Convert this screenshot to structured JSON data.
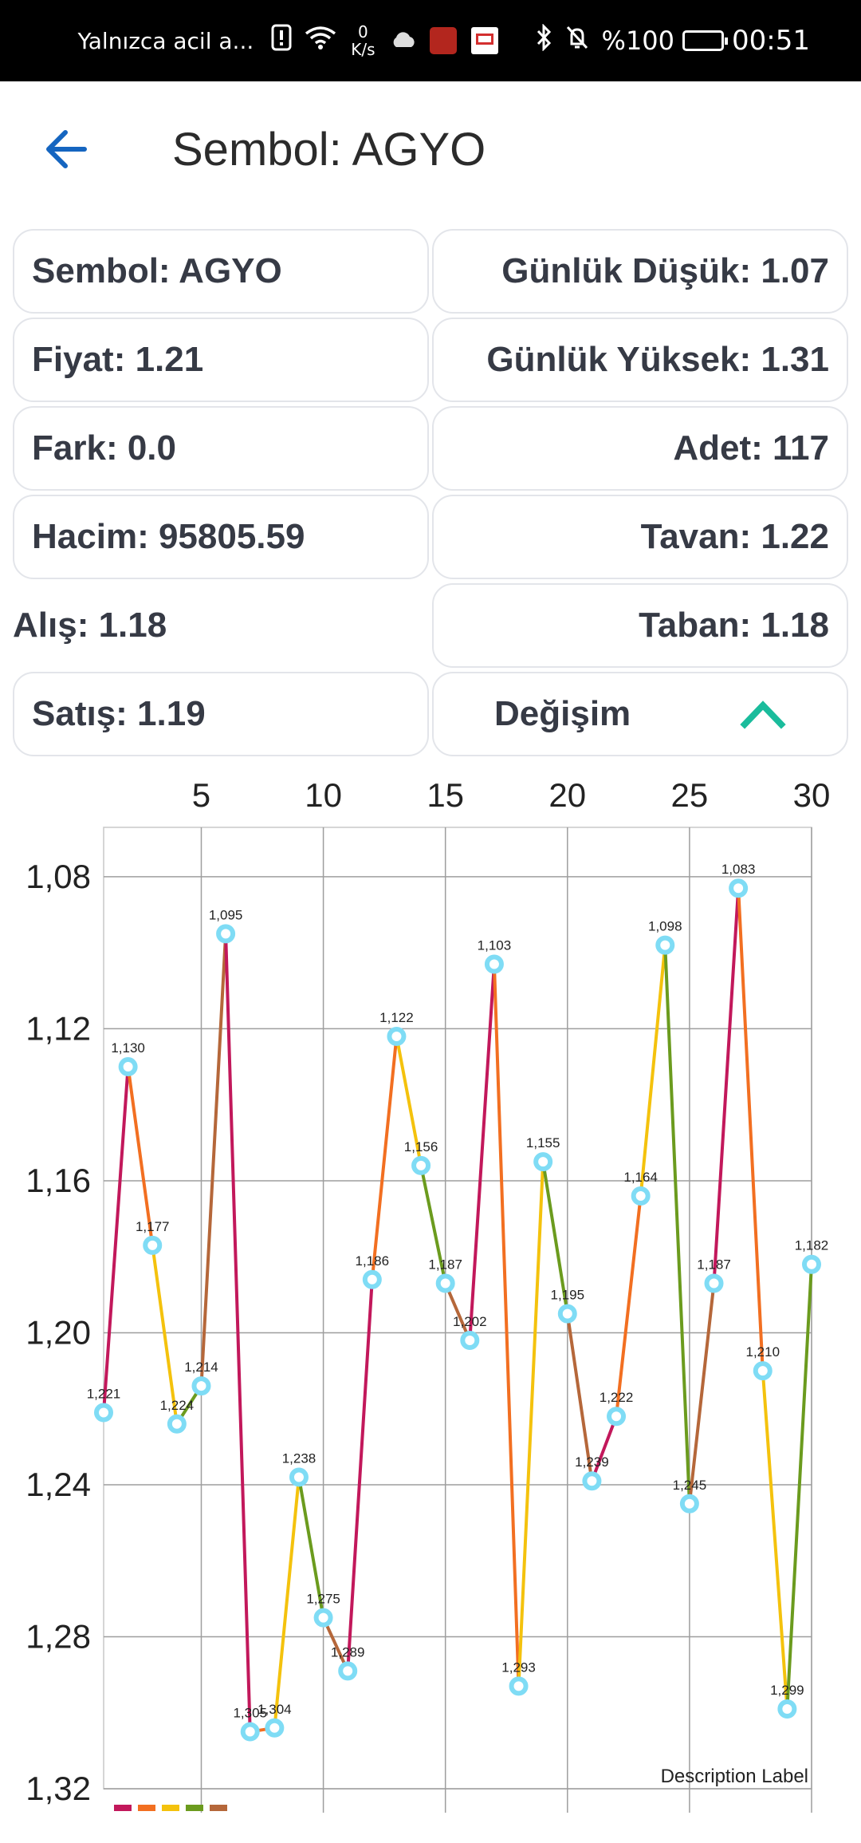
{
  "status_bar": {
    "carrier_text": "Yalnızca acil a...",
    "net_speed_value": "0",
    "net_speed_unit": "K/s",
    "battery": "%100",
    "time": "00:51",
    "icons": [
      "alert-icon",
      "wifi-icon",
      "cloud-icon",
      "app-badge-icon",
      "news-icon",
      "bluetooth-icon",
      "mute-icon",
      "battery-icon"
    ]
  },
  "header": {
    "title": "Sembol: AGYO",
    "back_icon": "arrow-left-icon"
  },
  "details": {
    "symbol": "Sembol: AGYO",
    "daily_low": "Günlük Düşük: 1.07",
    "price": "Fiyat: 1.21",
    "daily_high": "Günlük Yüksek: 1.31",
    "diff": "Fark: 0.0",
    "count": "Adet: 117",
    "volume": "Hacim: 95805.59",
    "ceiling": "Tavan: 1.22",
    "bid": "Alış: 1.18",
    "floor": "Taban: 1.18",
    "ask": "Satış: 1.19",
    "change_label": "Değişim",
    "change_icon": "chevron-up-icon"
  },
  "colors": {
    "accent": "#1565c0",
    "up": "#1abc9c",
    "point": "#7fdcf5"
  },
  "chart_data": {
    "type": "line",
    "x": [
      1,
      2,
      3,
      4,
      5,
      6,
      7,
      8,
      9,
      10,
      11,
      12,
      13,
      14,
      15,
      16,
      17,
      18,
      19,
      20,
      21,
      22,
      23,
      24,
      25,
      26,
      27,
      28,
      29,
      30
    ],
    "values": [
      1.221,
      1.13,
      1.177,
      1.224,
      1.214,
      1.095,
      1.305,
      1.304,
      1.238,
      1.275,
      1.289,
      1.186,
      1.122,
      1.156,
      1.187,
      1.202,
      1.103,
      1.293,
      1.155,
      1.195,
      1.239,
      1.222,
      1.164,
      1.098,
      1.245,
      1.187,
      1.083,
      1.21,
      1.299,
      1.182
    ],
    "point_labels": [
      "1,221",
      "1,130",
      "1,177",
      "1,224",
      "1,214",
      "1,095",
      "1,305",
      "1,304",
      "1,238",
      "1,275",
      "1,289",
      "1,186",
      "1,122",
      "1,156",
      "1,187",
      "1,202",
      "1,103",
      "1,293",
      "1,155",
      "1,195",
      "1,239",
      "1,222",
      "1,164",
      "1,098",
      "1,245",
      "1,187",
      "1,083",
      "1,210",
      "1,299",
      "1,182"
    ],
    "x_ticks": [
      "5",
      "10",
      "15",
      "20",
      "25",
      "30"
    ],
    "y_ticks": [
      "1,08",
      "1,12",
      "1,16",
      "1,20",
      "1,24",
      "1,28",
      "1,32"
    ],
    "y_inverted": true,
    "xlim": [
      1,
      30
    ],
    "ylim": [
      1.32,
      1.067
    ],
    "description_label": "Description Label",
    "segment_colors": [
      "#c2185b",
      "#f26f21",
      "#f4c20d",
      "#6b9b1e",
      "#b5673a"
    ],
    "grid": true,
    "legend_position": "bottom-left"
  }
}
